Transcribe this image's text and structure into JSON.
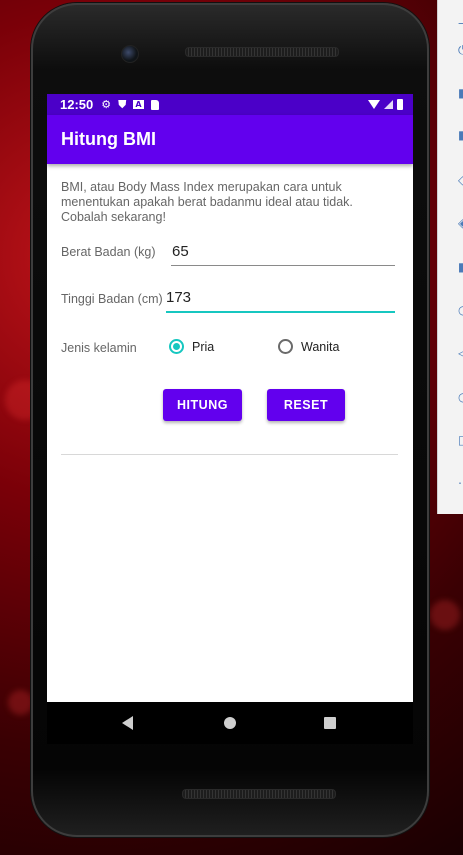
{
  "status_bar": {
    "time": "12:50",
    "icons": [
      "gear-icon",
      "shield-icon",
      "a-icon",
      "sd-card-icon"
    ],
    "right_icons": [
      "wifi-icon",
      "signal-icon",
      "battery-icon"
    ]
  },
  "app_bar": {
    "title": "Hitung BMI"
  },
  "main": {
    "description": "BMI, atau Body Mass Index merupakan cara untuk menentukan apakah berat badanmu ideal atau tidak. Cobalah sekarang!",
    "weight": {
      "label": "Berat Badan (kg)",
      "value": "65"
    },
    "height": {
      "label": "Tinggi Badan (cm)",
      "value": "173"
    },
    "gender": {
      "label": "Jenis kelamin",
      "options": [
        {
          "label": "Pria",
          "checked": true
        },
        {
          "label": "Wanita",
          "checked": false
        }
      ]
    },
    "buttons": {
      "calculate": "HITUNG",
      "reset": "RESET"
    }
  },
  "colors": {
    "primary": "#6200ee",
    "primary_dark": "#4b00c8",
    "accent": "#16c7c0"
  }
}
